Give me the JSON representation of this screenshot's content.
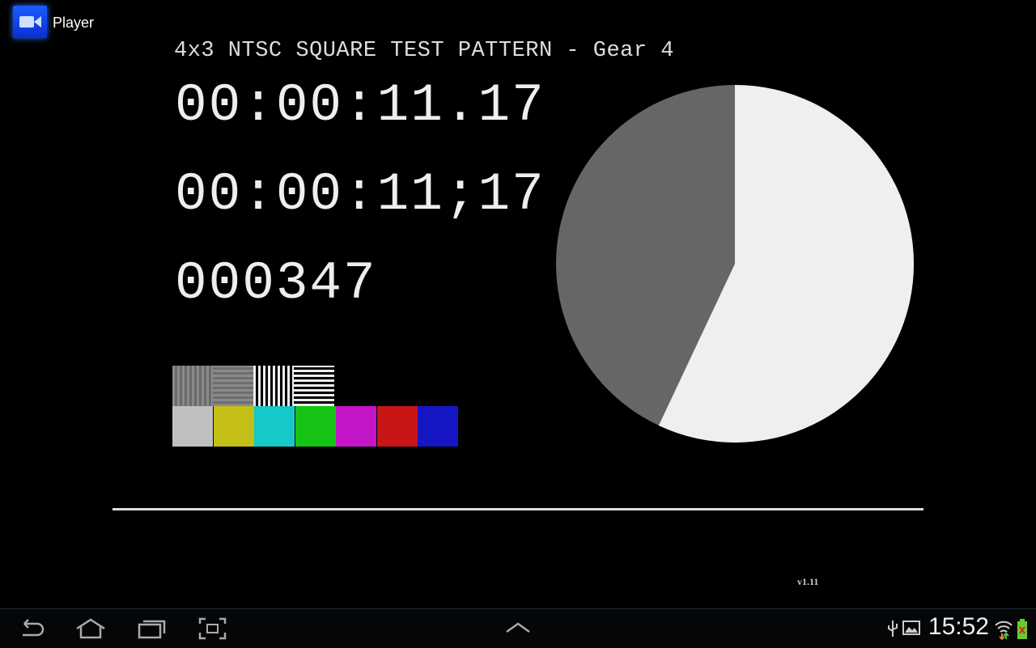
{
  "app": {
    "title": "Player",
    "icon": "video-camera-icon"
  },
  "video": {
    "title": "4x3 NTSC SQUARE TEST PATTERN - Gear 4",
    "timecode_nondrop": "00:00:11.17",
    "timecode_drop": "00:00:11;17",
    "frame_count": "000347",
    "version": "v1.11",
    "pie_fraction_light": 0.57,
    "colors": {
      "pie_light": "#eeefee",
      "pie_dark": "#666666"
    },
    "pattern_blocks": [
      "fine-vertical-gray",
      "fine-horizontal-gray",
      "vertical-bw",
      "horizontal-bw"
    ],
    "color_bars": [
      "#c0c0c0",
      "#c4bf16",
      "#16c8c8",
      "#16c416",
      "#c416c8",
      "#c81616",
      "#1616c4"
    ]
  },
  "navbar": {
    "buttons": [
      "back-icon",
      "home-icon",
      "recent-apps-icon",
      "screenshot-icon",
      "up-chevron-icon"
    ],
    "status_icons": [
      "usb-icon",
      "gallery-icon",
      "wifi-icon",
      "battery-icon"
    ],
    "clock": "15:52"
  }
}
